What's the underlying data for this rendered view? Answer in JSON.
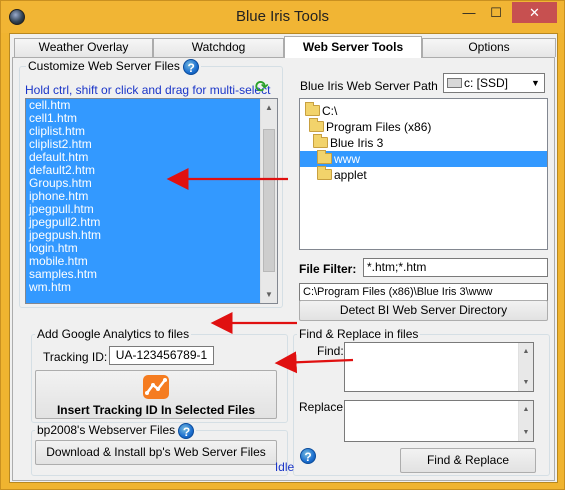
{
  "window": {
    "title": "Blue Iris Tools",
    "minimize_glyph": "—",
    "maximize_glyph": "☐",
    "close_glyph": "✕"
  },
  "tabs": [
    {
      "label": "Weather Overlay",
      "active": false
    },
    {
      "label": "Watchdog",
      "active": false
    },
    {
      "label": "Web Server Tools",
      "active": true
    },
    {
      "label": "Options",
      "active": false
    }
  ],
  "customize": {
    "group_label": "Customize Web Server Files",
    "hint": "Hold ctrl, shift or click and drag for multi-select",
    "files": [
      "cell.htm",
      "cell1.htm",
      "cliplist.htm",
      "cliplist2.htm",
      "default.htm",
      "default2.htm",
      "Groups.htm",
      "iphone.htm",
      "jpegpull.htm",
      "jpegpull2.htm",
      "jpegpush.htm",
      "login.htm",
      "mobile.htm",
      "samples.htm",
      "wm.htm"
    ]
  },
  "path": {
    "label": "Blue Iris Web Server Path",
    "drive_value": "c: [SSD]",
    "tree": [
      {
        "label": "C:\\",
        "icon": "drive-icon",
        "selected": false
      },
      {
        "label": "Program Files (x86)",
        "icon": "folder-icon",
        "selected": false
      },
      {
        "label": "Blue Iris 3",
        "icon": "folder-icon",
        "selected": false
      },
      {
        "label": "www",
        "icon": "folder-open-icon",
        "selected": true
      },
      {
        "label": "applet",
        "icon": "folder-icon",
        "selected": false
      }
    ],
    "filter_label": "File Filter:",
    "filter_value": "*.htm;*.htm",
    "path_value": "C:\\Program Files (x86)\\Blue Iris 3\\www",
    "detect_button": "Detect BI Web Server Directory"
  },
  "analytics": {
    "group_label": "Add Google Analytics to files",
    "tracking_label": "Tracking ID:",
    "tracking_value": "UA-123456789-1",
    "insert_button": "Insert Tracking ID In Selected Files"
  },
  "bp": {
    "group_label": "bp2008's Webserver Files",
    "download_button": "Download & Install bp's Web Server Files"
  },
  "find_replace": {
    "group_label": "Find & Replace in files",
    "find_label": "Find:",
    "replace_label": "Replace:",
    "button": "Find & Replace"
  },
  "status": "Idle",
  "colors": {
    "title_bar": "#f1b534",
    "selection": "#3399ff",
    "hint_text": "#1a35c8",
    "arrow": "#e01010",
    "close_button": "#c75050"
  }
}
